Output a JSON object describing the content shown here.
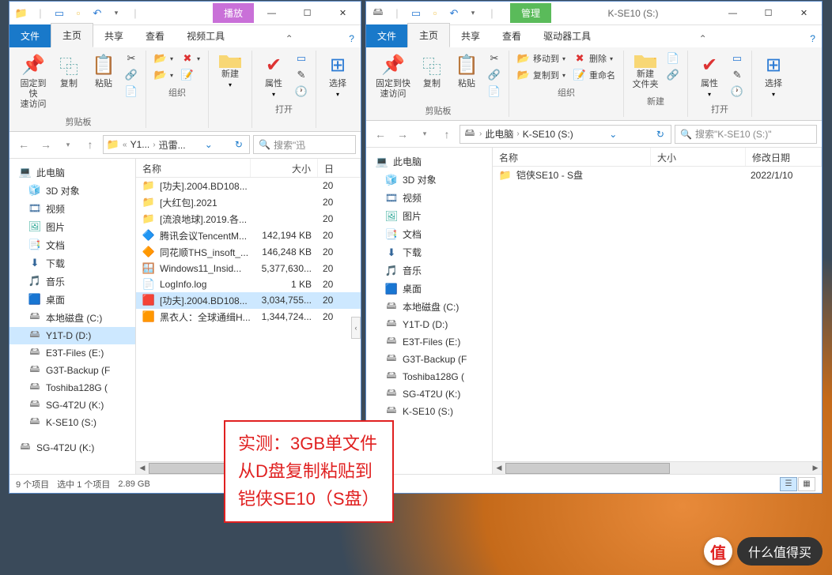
{
  "annotation": {
    "line1": "实测：3GB单文件",
    "line2": "从D盘复制粘贴到",
    "line3": "铠侠SE10（S盘）"
  },
  "watermark": {
    "badge": "值",
    "text": "什么值得买"
  },
  "win1": {
    "contextual_tab": "播放",
    "title": "",
    "tabs": {
      "file": "文件",
      "home": "主页",
      "share": "共享",
      "view": "查看",
      "video": "视频工具"
    },
    "ribbon": {
      "pin": "固定到快\n速访问",
      "copy": "复制",
      "paste": "粘贴",
      "clipboard_label": "剪贴板",
      "new": "新建",
      "organize_label": "组织",
      "properties": "属性",
      "open_label": "打开",
      "select": "选择"
    },
    "breadcrumb": {
      "b1": "Y1...",
      "b2": "迅雷..."
    },
    "search_placeholder": "搜索\"迅",
    "cols": {
      "name": "名称",
      "size": "大小",
      "date": "日"
    },
    "files": [
      {
        "ico": "📁",
        "cls": "ico-folder",
        "name": "[功夫].2004.BD108...",
        "size": "",
        "date": "20"
      },
      {
        "ico": "📁",
        "cls": "ico-folder",
        "name": "[大红包].2021",
        "size": "",
        "date": "20"
      },
      {
        "ico": "📁",
        "cls": "ico-folder",
        "name": "[流浪地球].2019.各...",
        "size": "",
        "date": "20"
      },
      {
        "ico": "🔷",
        "cls": "ico-pc",
        "name": "腾讯会议TencentM...",
        "size": "142,194 KB",
        "date": "20"
      },
      {
        "ico": "🔶",
        "cls": "",
        "name": "同花顺THS_insoft_...",
        "size": "146,248 KB",
        "date": "20"
      },
      {
        "ico": "🪟",
        "cls": "ico-pc",
        "name": "Windows11_Insid...",
        "size": "5,377,630...",
        "date": "20"
      },
      {
        "ico": "📄",
        "cls": "",
        "name": "LogInfo.log",
        "size": "1 KB",
        "date": "20"
      },
      {
        "ico": "🟥",
        "cls": "",
        "name": "[功夫].2004.BD108...",
        "size": "3,034,755...",
        "date": "20",
        "selected": true
      },
      {
        "ico": "🟧",
        "cls": "",
        "name": "黑衣人：全球通缉H...",
        "size": "1,344,724...",
        "date": "20"
      }
    ],
    "status": {
      "count": "9 个项目",
      "selection": "选中 1 个项目",
      "size": "2.89 GB"
    }
  },
  "win2": {
    "contextual_tab": "管理",
    "title": "K-SE10 (S:)",
    "tabs": {
      "file": "文件",
      "home": "主页",
      "share": "共享",
      "view": "查看",
      "drive": "驱动器工具"
    },
    "ribbon": {
      "pin": "固定到快\n速访问",
      "copy": "复制",
      "paste": "粘贴",
      "clipboard_label": "剪贴板",
      "moveto": "移动到",
      "copyto": "复制到",
      "delete": "删除",
      "rename": "重命名",
      "organize_label": "组织",
      "newfolder": "新建\n文件夹",
      "new_label": "新建",
      "properties": "属性",
      "open_label": "打开",
      "select": "选择"
    },
    "breadcrumb": {
      "b1": "此电脑",
      "b2": "K-SE10 (S:)"
    },
    "search_placeholder": "搜索\"K-SE10 (S:)\"",
    "cols": {
      "name": "名称",
      "size": "大小",
      "date": "修改日期"
    },
    "files": [
      {
        "ico": "📁",
        "cls": "ico-folder",
        "name": "铠侠SE10 - S盘",
        "size": "",
        "date": "2022/1/10"
      }
    ],
    "status": {
      "count": ""
    }
  },
  "tree": {
    "thispc": "此电脑",
    "items": [
      {
        "ico": "🧊",
        "cls": "ico-3d",
        "label": "3D 对象"
      },
      {
        "ico": "🎞",
        "cls": "ico-vid",
        "label": "视频"
      },
      {
        "ico": "🖼",
        "cls": "ico-pic",
        "label": "图片"
      },
      {
        "ico": "📑",
        "cls": "ico-doc",
        "label": "文档"
      },
      {
        "ico": "⬇",
        "cls": "ico-dl",
        "label": "下载"
      },
      {
        "ico": "🎵",
        "cls": "ico-music",
        "label": "音乐"
      },
      {
        "ico": "🟦",
        "cls": "ico-desk",
        "label": "桌面"
      },
      {
        "ico": "🖴",
        "cls": "ico-drive",
        "label": "本地磁盘 (C:)"
      },
      {
        "ico": "🖴",
        "cls": "ico-drive",
        "label": "Y1T-D (D:)",
        "sel1": true
      },
      {
        "ico": "🖴",
        "cls": "ico-drive",
        "label": "E3T-Files (E:)"
      },
      {
        "ico": "🖴",
        "cls": "ico-drive",
        "label": "G3T-Backup (F"
      },
      {
        "ico": "🖴",
        "cls": "ico-drive",
        "label": "Toshiba128G ("
      },
      {
        "ico": "🖴",
        "cls": "ico-drive",
        "label": "SG-4T2U (K:)"
      },
      {
        "ico": "🖴",
        "cls": "ico-drive",
        "label": "K-SE10 (S:)"
      }
    ],
    "extra_w1": {
      "ico": "🖴",
      "cls": "ico-drive",
      "label": "SG-4T2U (K:)"
    }
  }
}
